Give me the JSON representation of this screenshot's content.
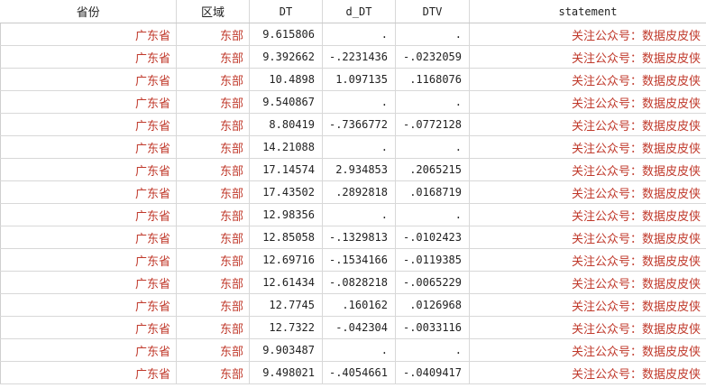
{
  "headers": [
    "省份",
    "区域",
    "DT",
    "d_DT",
    "DTV",
    "statement"
  ],
  "rows": [
    [
      "广东省",
      "东部",
      "9.615806",
      ".",
      ".",
      "关注公众号：数据皮皮侠"
    ],
    [
      "广东省",
      "东部",
      "9.392662",
      "-.2231436",
      "-.0232059",
      "关注公众号：数据皮皮侠"
    ],
    [
      "广东省",
      "东部",
      "10.4898",
      "1.097135",
      ".1168076",
      "关注公众号：数据皮皮侠"
    ],
    [
      "广东省",
      "东部",
      "9.540867",
      ".",
      ".",
      "关注公众号：数据皮皮侠"
    ],
    [
      "广东省",
      "东部",
      "8.80419",
      "-.7366772",
      "-.0772128",
      "关注公众号：数据皮皮侠"
    ],
    [
      "广东省",
      "东部",
      "14.21088",
      ".",
      ".",
      "关注公众号：数据皮皮侠"
    ],
    [
      "广东省",
      "东部",
      "17.14574",
      "2.934853",
      ".2065215",
      "关注公众号：数据皮皮侠"
    ],
    [
      "广东省",
      "东部",
      "17.43502",
      ".2892818",
      ".0168719",
      "关注公众号：数据皮皮侠"
    ],
    [
      "广东省",
      "东部",
      "12.98356",
      ".",
      ".",
      "关注公众号：数据皮皮侠"
    ],
    [
      "广东省",
      "东部",
      "12.85058",
      "-.1329813",
      "-.0102423",
      "关注公众号：数据皮皮侠"
    ],
    [
      "广东省",
      "东部",
      "12.69716",
      "-.1534166",
      "-.0119385",
      "关注公众号：数据皮皮侠"
    ],
    [
      "广东省",
      "东部",
      "12.61434",
      "-.0828218",
      "-.0065229",
      "关注公众号：数据皮皮侠"
    ],
    [
      "广东省",
      "东部",
      "12.7745",
      ".160162",
      ".0126968",
      "关注公众号：数据皮皮侠"
    ],
    [
      "广东省",
      "东部",
      "12.7322",
      "-.042304",
      "-.0033116",
      "关注公众号：数据皮皮侠"
    ],
    [
      "广东省",
      "东部",
      "9.903487",
      ".",
      ".",
      "关注公众号：数据皮皮侠"
    ],
    [
      "广东省",
      "东部",
      "9.498021",
      "-.4054661",
      "-.0409417",
      "关注公众号：数据皮皮侠"
    ]
  ],
  "colors": {
    "string_text": "#c0392b",
    "number_text": "#222222",
    "grid": "#d8d8d8"
  }
}
